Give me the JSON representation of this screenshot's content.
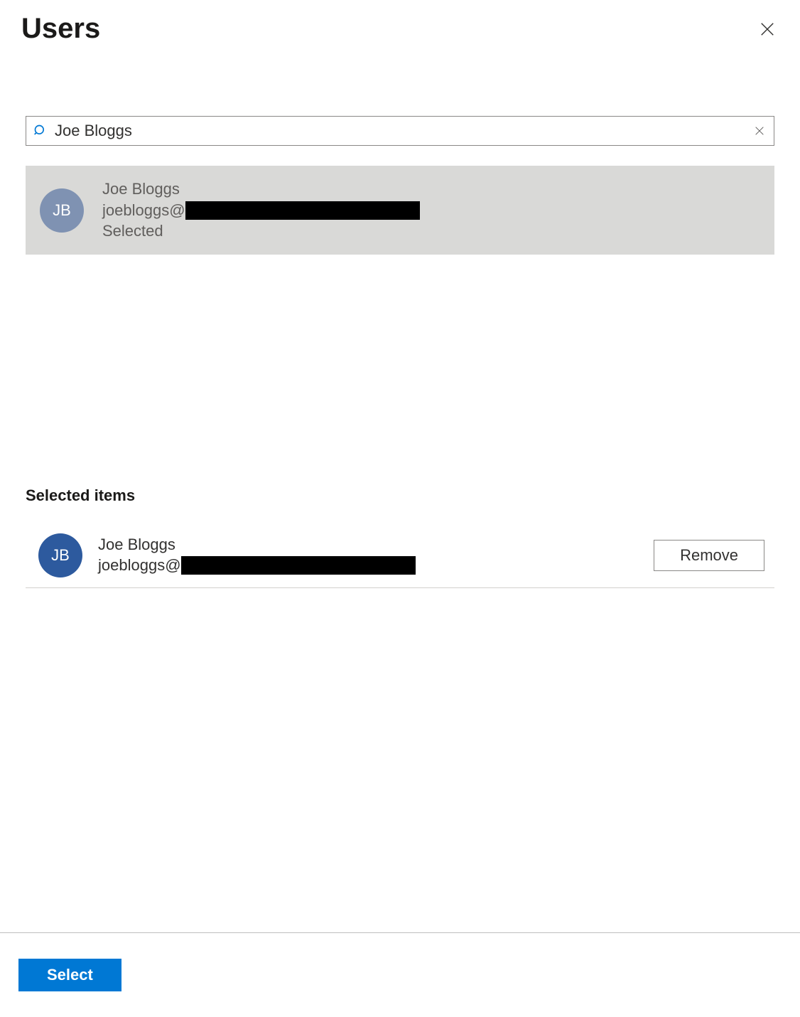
{
  "header": {
    "title": "Users"
  },
  "search": {
    "value": "Joe Bloggs"
  },
  "results": [
    {
      "initials": "JB",
      "name": "Joe Bloggs",
      "email_prefix": "joebloggs@",
      "status": "Selected"
    }
  ],
  "selected": {
    "title": "Selected items",
    "items": [
      {
        "initials": "JB",
        "name": "Joe Bloggs",
        "email_prefix": "joebloggs@",
        "remove_label": "Remove"
      }
    ]
  },
  "footer": {
    "select_label": "Select"
  }
}
